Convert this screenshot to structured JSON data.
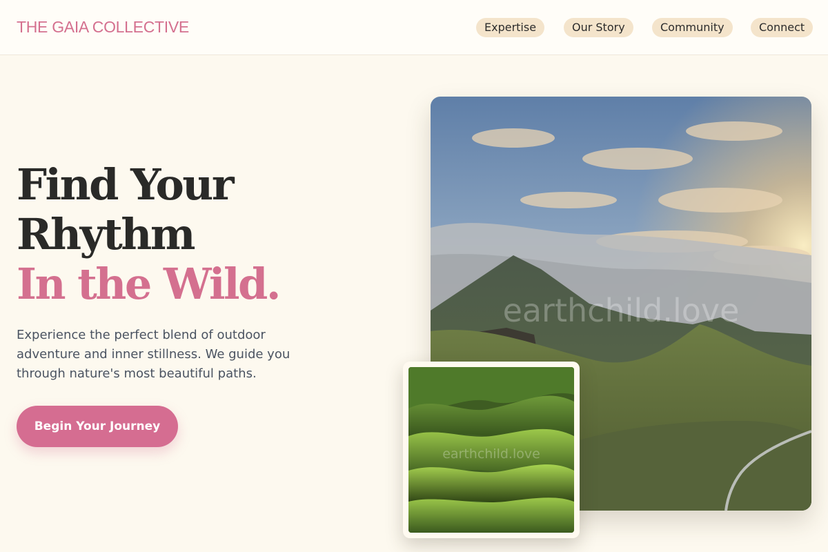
{
  "header": {
    "brand": "THE GAIA COLLECTIVE",
    "nav": [
      {
        "label": "Expertise"
      },
      {
        "label": "Our Story"
      },
      {
        "label": "Community"
      },
      {
        "label": "Connect"
      }
    ]
  },
  "hero": {
    "title_lines": [
      "Find Your",
      "Rhythm"
    ],
    "title_accent": "In the Wild.",
    "description": "Experience the perfect blend of outdoor adventure and inner stillness. We guide you through nature's most beautiful paths.",
    "cta_label": "Begin Your Journey"
  },
  "images": {
    "main_watermark": "earthchild.love",
    "small_watermark": "earthchild.love"
  },
  "colors": {
    "accent": "#d4708f",
    "background": "#fdf9ef",
    "nav_pill": "#f4e4cb",
    "heading": "#2a2a28",
    "body_text": "#4a5361"
  }
}
